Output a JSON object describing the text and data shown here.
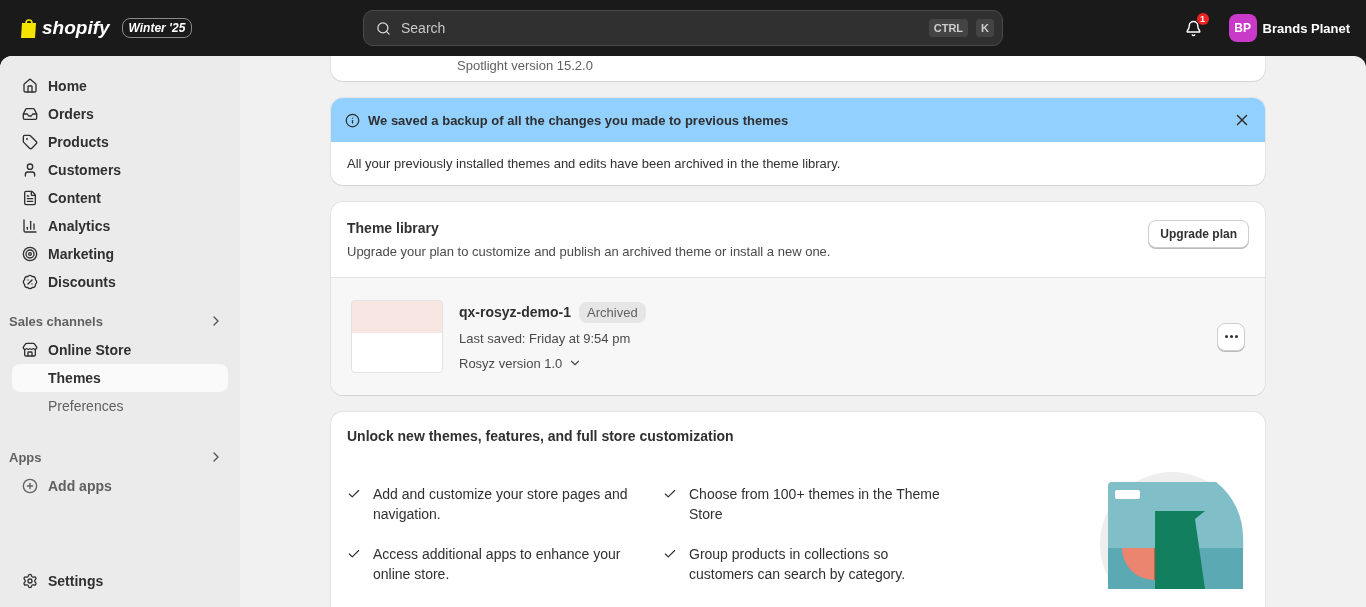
{
  "topbar": {
    "brand": "shopify",
    "edition": "Winter '25",
    "search": {
      "placeholder": "Search",
      "keys": [
        "CTRL",
        "K"
      ]
    },
    "notifications": "1",
    "account": {
      "initials": "BP",
      "name": "Brands Planet"
    }
  },
  "sidebar": {
    "items": [
      {
        "label": "Home",
        "selected": false
      },
      {
        "label": "Orders",
        "selected": false
      },
      {
        "label": "Products",
        "selected": false
      },
      {
        "label": "Customers",
        "selected": false
      },
      {
        "label": "Content",
        "selected": false
      },
      {
        "label": "Analytics",
        "selected": false
      },
      {
        "label": "Marketing",
        "selected": false
      },
      {
        "label": "Discounts",
        "selected": false
      }
    ],
    "sales_channels": {
      "title": "Sales channels",
      "channel": "Online Store",
      "children": [
        {
          "label": "Themes",
          "selected": true
        },
        {
          "label": "Preferences",
          "selected": false
        }
      ]
    },
    "apps": {
      "title": "Apps",
      "items": [
        {
          "label": "Add apps"
        }
      ]
    },
    "settings": "Settings"
  },
  "current_theme": {
    "version": "Spotlight version 15.2.0"
  },
  "banner": {
    "title": "We saved a backup of all the changes you made to previous themes",
    "body": "All your previously installed themes and edits have been archived in the theme library."
  },
  "theme_library": {
    "title": "Theme library",
    "subtitle": "Upgrade your plan to customize and publish an archived theme or install a new one.",
    "button": "Upgrade plan",
    "themes": [
      {
        "name": "qx-rosyz-demo-1",
        "badge": "Archived",
        "saved": "Last saved: Friday at 9:54 pm",
        "version": "Rosyz version 1.0"
      }
    ]
  },
  "upsell": {
    "title": "Unlock new themes, features, and full store customization",
    "features": [
      "Add and customize your store pages and navigation.",
      "Choose from 100+ themes in the Theme Store",
      "Access additional apps to enhance your online store.",
      "Group products in collections so customers can search by category."
    ]
  }
}
